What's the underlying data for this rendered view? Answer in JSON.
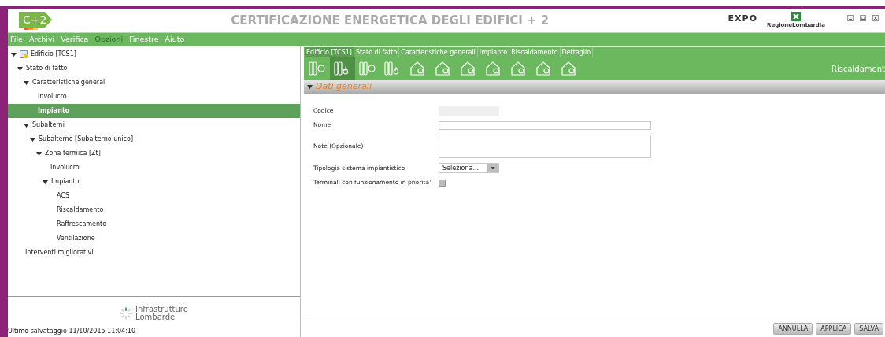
{
  "header": {
    "logo": "C+2",
    "title": "**C**ERTIFICAZIONE **EN**ERGETICA DEGLI **ED**IFICI **+ 2**",
    "expo_logo": "EXPO",
    "region_logo": "RegioneLombardia"
  },
  "menu": [
    {
      "label": "File",
      "disabled": false
    },
    {
      "label": "Archivi",
      "disabled": false
    },
    {
      "label": "Verifica",
      "disabled": false
    },
    {
      "label": "Opzioni",
      "disabled": true
    },
    {
      "label": "Finestre",
      "disabled": false
    },
    {
      "label": "Aiuto",
      "disabled": false
    }
  ],
  "tree": [
    {
      "label": "Edificio [TCS1]",
      "expanded": true,
      "selected": false,
      "kind": "root",
      "children": [
        {
          "label": "Stato di fatto",
          "expanded": true,
          "selected": false,
          "children": [
            {
              "label": "Caratteristiche generali",
              "expanded": true,
              "selected": false,
              "children": [
                {
                  "label": "Involucro",
                  "selected": false
                },
                {
                  "label": "Impianto",
                  "selected": true
                }
              ]
            },
            {
              "label": "Subalterni",
              "expanded": true,
              "selected": false,
              "children": [
                {
                  "label": "Subalterno [Subalterno unico]",
                  "expanded": true,
                  "selected": false,
                  "children": [
                    {
                      "label": "Zona termica [Zt]",
                      "expanded": true,
                      "selected": false,
                      "children": [
                        {
                          "label": "Involucro",
                          "selected": false
                        },
                        {
                          "label": "Impianto",
                          "expanded": true,
                          "selected": false,
                          "children": [
                            {
                              "label": "ACS",
                              "selected": false
                            },
                            {
                              "label": "Riscaldamento",
                              "selected": false
                            },
                            {
                              "label": "Raffrescamento",
                              "selected": false
                            },
                            {
                              "label": "Ventilazione",
                              "selected": false
                            }
                          ]
                        }
                      ]
                    }
                  ]
                }
              ]
            }
          ]
        },
        {
          "label": "Interventi migliorativi",
          "selected": false
        }
      ]
    }
  ],
  "company_logo": {
    "line1": "Infrastrutture",
    "line2": "Lombarde"
  },
  "status_bar": "Ultimo salvataggio 11/10/2015 11:04:10",
  "breadcrumb": [
    {
      "label": "Edificio [TCS1]",
      "selected": true
    },
    {
      "label": "Stato di fatto",
      "selected": false
    },
    {
      "label": "Caratteristiche generali",
      "selected": false
    },
    {
      "label": "Impianto",
      "selected": false
    },
    {
      "label": "Riscaldamento",
      "selected": false
    },
    {
      "label": "Dettaglio",
      "selected": false
    }
  ],
  "toolbar": {
    "tools": [
      {
        "kind": "radiator",
        "selected": false
      },
      {
        "kind": "radiator",
        "selected": true
      },
      {
        "kind": "radiator",
        "selected": false
      },
      {
        "kind": "radiator",
        "selected": false
      },
      {
        "kind": "house",
        "selected": false
      },
      {
        "kind": "house",
        "selected": false
      },
      {
        "kind": "house",
        "selected": false
      },
      {
        "kind": "house",
        "selected": false
      },
      {
        "kind": "house",
        "selected": false
      },
      {
        "kind": "house",
        "selected": false
      },
      {
        "kind": "house",
        "selected": false
      }
    ],
    "label": "Riscaldament"
  },
  "section": {
    "title": "Dati generali",
    "expanded": true
  },
  "form": [
    {
      "kind": "readonly",
      "label": "Codice"
    },
    {
      "kind": "text",
      "label": "Nome"
    },
    {
      "kind": "textarea",
      "label": "Note (Opzionale)"
    },
    {
      "kind": "select",
      "label": "Tipologia sistema impiantistico",
      "value": "Seleziona..."
    },
    {
      "kind": "checkbox",
      "label": "Terminali con funzionamento in priorita'",
      "checked": false
    }
  ],
  "buttons": [
    "ANNULLA",
    "APPLICA",
    "SALVA"
  ]
}
